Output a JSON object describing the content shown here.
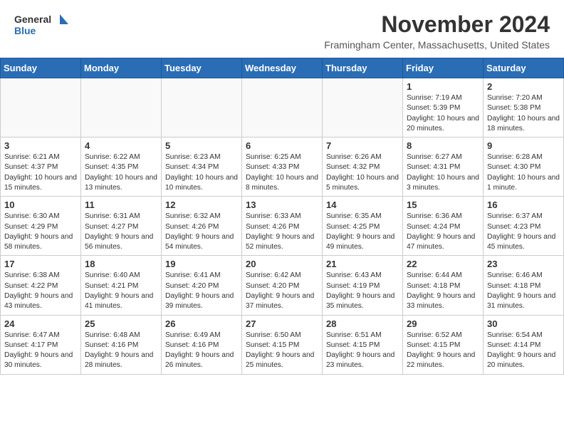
{
  "header": {
    "logo_general": "General",
    "logo_blue": "Blue",
    "month_title": "November 2024",
    "location": "Framingham Center, Massachusetts, United States"
  },
  "calendar": {
    "days_of_week": [
      "Sunday",
      "Monday",
      "Tuesday",
      "Wednesday",
      "Thursday",
      "Friday",
      "Saturday"
    ],
    "weeks": [
      [
        {
          "day": "",
          "info": ""
        },
        {
          "day": "",
          "info": ""
        },
        {
          "day": "",
          "info": ""
        },
        {
          "day": "",
          "info": ""
        },
        {
          "day": "",
          "info": ""
        },
        {
          "day": "1",
          "info": "Sunrise: 7:19 AM\nSunset: 5:39 PM\nDaylight: 10 hours and 20 minutes."
        },
        {
          "day": "2",
          "info": "Sunrise: 7:20 AM\nSunset: 5:38 PM\nDaylight: 10 hours and 18 minutes."
        }
      ],
      [
        {
          "day": "3",
          "info": "Sunrise: 6:21 AM\nSunset: 4:37 PM\nDaylight: 10 hours and 15 minutes."
        },
        {
          "day": "4",
          "info": "Sunrise: 6:22 AM\nSunset: 4:35 PM\nDaylight: 10 hours and 13 minutes."
        },
        {
          "day": "5",
          "info": "Sunrise: 6:23 AM\nSunset: 4:34 PM\nDaylight: 10 hours and 10 minutes."
        },
        {
          "day": "6",
          "info": "Sunrise: 6:25 AM\nSunset: 4:33 PM\nDaylight: 10 hours and 8 minutes."
        },
        {
          "day": "7",
          "info": "Sunrise: 6:26 AM\nSunset: 4:32 PM\nDaylight: 10 hours and 5 minutes."
        },
        {
          "day": "8",
          "info": "Sunrise: 6:27 AM\nSunset: 4:31 PM\nDaylight: 10 hours and 3 minutes."
        },
        {
          "day": "9",
          "info": "Sunrise: 6:28 AM\nSunset: 4:30 PM\nDaylight: 10 hours and 1 minute."
        }
      ],
      [
        {
          "day": "10",
          "info": "Sunrise: 6:30 AM\nSunset: 4:29 PM\nDaylight: 9 hours and 58 minutes."
        },
        {
          "day": "11",
          "info": "Sunrise: 6:31 AM\nSunset: 4:27 PM\nDaylight: 9 hours and 56 minutes."
        },
        {
          "day": "12",
          "info": "Sunrise: 6:32 AM\nSunset: 4:26 PM\nDaylight: 9 hours and 54 minutes."
        },
        {
          "day": "13",
          "info": "Sunrise: 6:33 AM\nSunset: 4:26 PM\nDaylight: 9 hours and 52 minutes."
        },
        {
          "day": "14",
          "info": "Sunrise: 6:35 AM\nSunset: 4:25 PM\nDaylight: 9 hours and 49 minutes."
        },
        {
          "day": "15",
          "info": "Sunrise: 6:36 AM\nSunset: 4:24 PM\nDaylight: 9 hours and 47 minutes."
        },
        {
          "day": "16",
          "info": "Sunrise: 6:37 AM\nSunset: 4:23 PM\nDaylight: 9 hours and 45 minutes."
        }
      ],
      [
        {
          "day": "17",
          "info": "Sunrise: 6:38 AM\nSunset: 4:22 PM\nDaylight: 9 hours and 43 minutes."
        },
        {
          "day": "18",
          "info": "Sunrise: 6:40 AM\nSunset: 4:21 PM\nDaylight: 9 hours and 41 minutes."
        },
        {
          "day": "19",
          "info": "Sunrise: 6:41 AM\nSunset: 4:20 PM\nDaylight: 9 hours and 39 minutes."
        },
        {
          "day": "20",
          "info": "Sunrise: 6:42 AM\nSunset: 4:20 PM\nDaylight: 9 hours and 37 minutes."
        },
        {
          "day": "21",
          "info": "Sunrise: 6:43 AM\nSunset: 4:19 PM\nDaylight: 9 hours and 35 minutes."
        },
        {
          "day": "22",
          "info": "Sunrise: 6:44 AM\nSunset: 4:18 PM\nDaylight: 9 hours and 33 minutes."
        },
        {
          "day": "23",
          "info": "Sunrise: 6:46 AM\nSunset: 4:18 PM\nDaylight: 9 hours and 31 minutes."
        }
      ],
      [
        {
          "day": "24",
          "info": "Sunrise: 6:47 AM\nSunset: 4:17 PM\nDaylight: 9 hours and 30 minutes."
        },
        {
          "day": "25",
          "info": "Sunrise: 6:48 AM\nSunset: 4:16 PM\nDaylight: 9 hours and 28 minutes."
        },
        {
          "day": "26",
          "info": "Sunrise: 6:49 AM\nSunset: 4:16 PM\nDaylight: 9 hours and 26 minutes."
        },
        {
          "day": "27",
          "info": "Sunrise: 6:50 AM\nSunset: 4:15 PM\nDaylight: 9 hours and 25 minutes."
        },
        {
          "day": "28",
          "info": "Sunrise: 6:51 AM\nSunset: 4:15 PM\nDaylight: 9 hours and 23 minutes."
        },
        {
          "day": "29",
          "info": "Sunrise: 6:52 AM\nSunset: 4:15 PM\nDaylight: 9 hours and 22 minutes."
        },
        {
          "day": "30",
          "info": "Sunrise: 6:54 AM\nSunset: 4:14 PM\nDaylight: 9 hours and 20 minutes."
        }
      ]
    ]
  }
}
